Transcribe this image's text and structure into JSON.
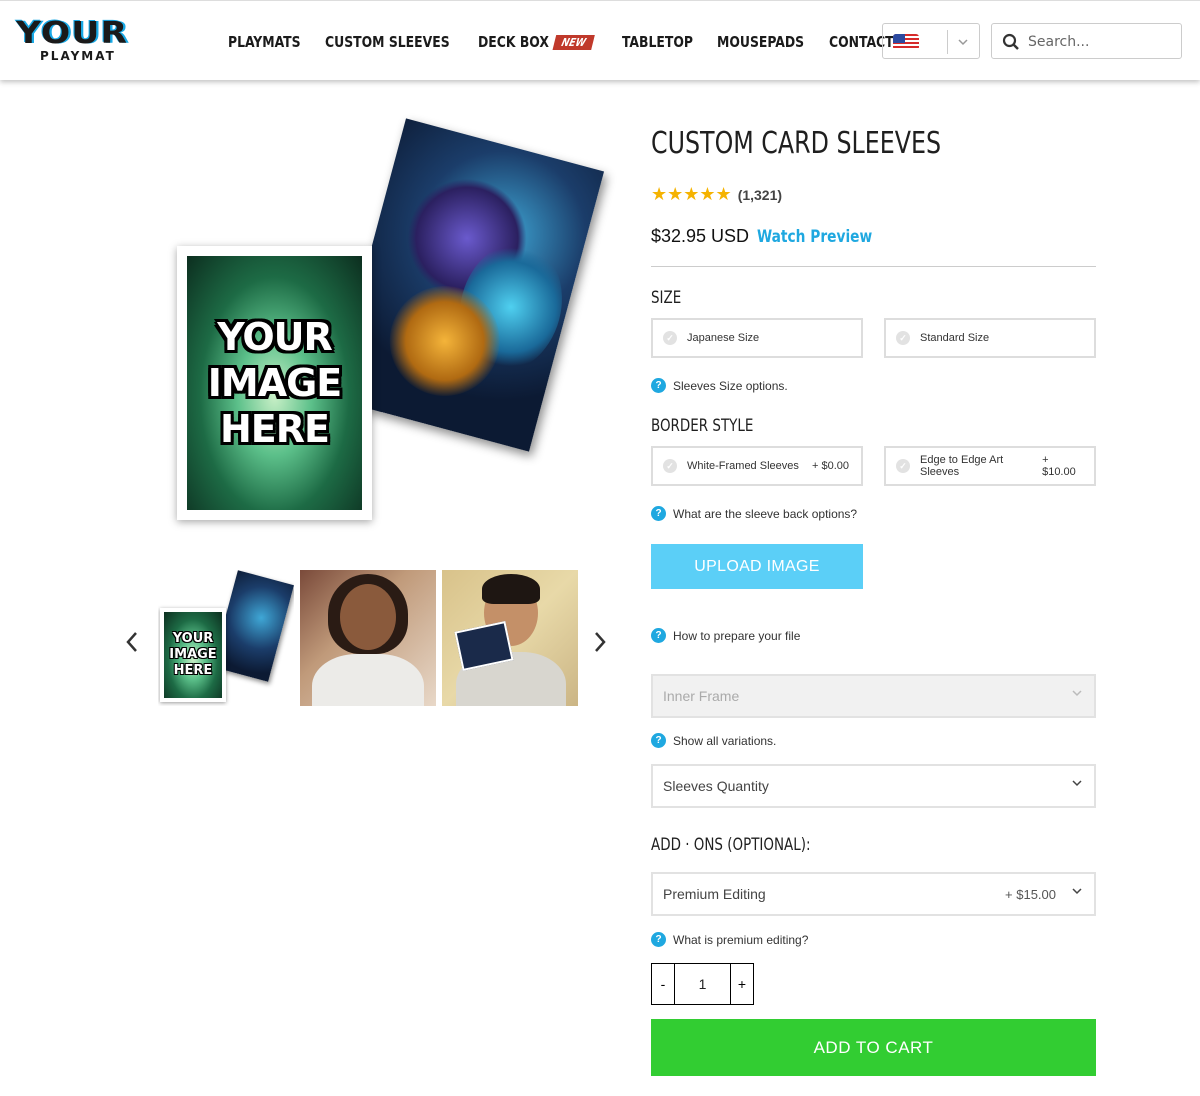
{
  "header": {
    "logo_main": "YOUR",
    "logo_sub": "PLAYMAT",
    "nav": [
      {
        "label": "PLAYMATS"
      },
      {
        "label": "CUSTOM SLEEVES"
      },
      {
        "label": "DECK BOX",
        "badge": "New"
      },
      {
        "label": "TABLETOP"
      },
      {
        "label": "MOUSEPADS"
      },
      {
        "label": "CONTACT"
      }
    ],
    "language_selector": {
      "flag": "us-flag-icon"
    },
    "search": {
      "placeholder": "Search..."
    }
  },
  "gallery": {
    "main_image_text": "YOUR\nIMAGE\nHERE",
    "thumbnails": [
      {
        "text": "YOUR\nIMAGE\nHERE"
      },
      {
        "text": ""
      },
      {
        "text": ""
      }
    ]
  },
  "product": {
    "title": "CUSTOM CARD SLEEVES",
    "rating_stars": 5,
    "review_count": "(1,321)",
    "price": "$32.95 USD",
    "watch_preview": "Watch Preview",
    "size": {
      "label": "SIZE",
      "options": [
        {
          "label": "Japanese Size"
        },
        {
          "label": "Standard Size"
        }
      ],
      "help": "Sleeves Size options."
    },
    "border_style": {
      "label": "BORDER STYLE",
      "options": [
        {
          "label": "White-Framed Sleeves",
          "price": "+ $0.00"
        },
        {
          "label": "Edge to Edge Art Sleeves",
          "price": "+ $10.00"
        }
      ],
      "help": "What are the sleeve back options?"
    },
    "upload_label": "UPLOAD IMAGE",
    "prepare_help": "How to prepare your file",
    "inner_frame_placeholder": "Inner Frame",
    "variations_help": "Show all variations.",
    "quantity_select": "Sleeves Quantity",
    "addons": {
      "label": "ADD · ONS (OPTIONAL):",
      "premium_editing": "Premium Editing",
      "premium_price": "+ $15.00",
      "help": "What is premium editing?"
    },
    "quantity": {
      "minus": "-",
      "value": "1",
      "plus": "+"
    },
    "add_to_cart": "ADD TO CART"
  },
  "colors": {
    "accent_blue": "#1fa8e0",
    "upload_button": "#5bcff7",
    "cart_button": "#32cd32",
    "new_badge": "#c0392b",
    "stars": "#f5b301"
  }
}
